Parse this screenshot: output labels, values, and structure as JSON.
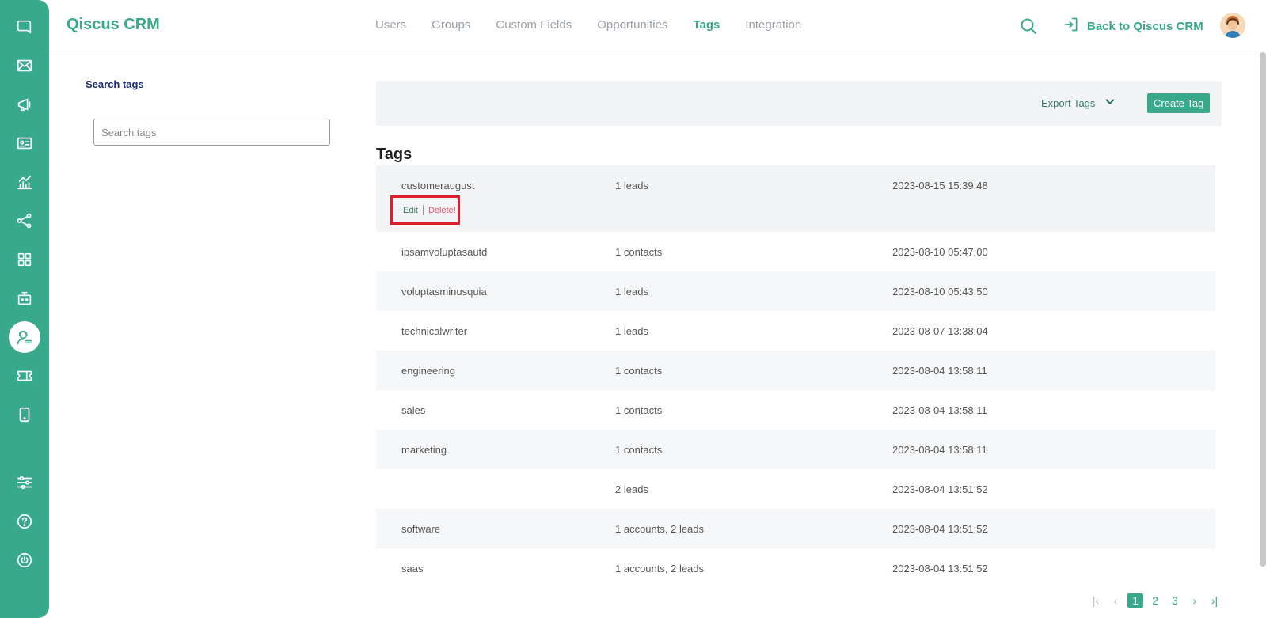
{
  "brand": "Qiscus CRM",
  "nav": [
    {
      "label": "Users"
    },
    {
      "label": "Groups"
    },
    {
      "label": "Custom Fields"
    },
    {
      "label": "Opportunities"
    },
    {
      "label": "Tags",
      "active": true
    },
    {
      "label": "Integration"
    }
  ],
  "header": {
    "back_label": "Back to Qiscus CRM"
  },
  "sidebar_icons": [
    "chat-icon",
    "mail-icon",
    "megaphone-icon",
    "contact-card-icon",
    "analytics-icon",
    "flow-icon",
    "apps-grid-icon",
    "bot-icon",
    "agent-icon",
    "ticket-icon",
    "mobile-icon",
    "settings-sliders-icon",
    "help-icon",
    "power-icon"
  ],
  "filter": {
    "title": "Search tags",
    "placeholder": "Search tags"
  },
  "toolbar": {
    "export_label": "Export Tags",
    "create_label": "Create Tag"
  },
  "section_title": "Tags",
  "row_actions": {
    "edit": "Edit",
    "delete": "Delete!"
  },
  "tags": [
    {
      "name": "customeraugust",
      "usage": "1 leads",
      "date": "2023-08-15 15:39:48"
    },
    {
      "name": "ipsamvoluptasautd",
      "usage": "1 contacts",
      "date": "2023-08-10 05:47:00"
    },
    {
      "name": "voluptasminusquia",
      "usage": "1 leads",
      "date": "2023-08-10 05:43:50"
    },
    {
      "name": "technicalwriter",
      "usage": "1 leads",
      "date": "2023-08-07 13:38:04"
    },
    {
      "name": "engineering",
      "usage": "1 contacts",
      "date": "2023-08-04 13:58:11"
    },
    {
      "name": "sales",
      "usage": "1 contacts",
      "date": "2023-08-04 13:58:11"
    },
    {
      "name": "marketing",
      "usage": "1 contacts",
      "date": "2023-08-04 13:58:11"
    },
    {
      "name": "",
      "usage": "2 leads",
      "date": "2023-08-04 13:51:52"
    },
    {
      "name": "software",
      "usage": "1 accounts, 2 leads",
      "date": "2023-08-04 13:51:52"
    },
    {
      "name": "saas",
      "usage": "1 accounts, 2 leads",
      "date": "2023-08-04 13:51:52"
    }
  ],
  "pagination": {
    "first": "|‹",
    "prev": "‹",
    "pages": [
      "1",
      "2",
      "3"
    ],
    "current": "1",
    "next": "›",
    "last": "›|"
  },
  "colors": {
    "accent": "#38a98a",
    "danger": "#e01e2b"
  }
}
